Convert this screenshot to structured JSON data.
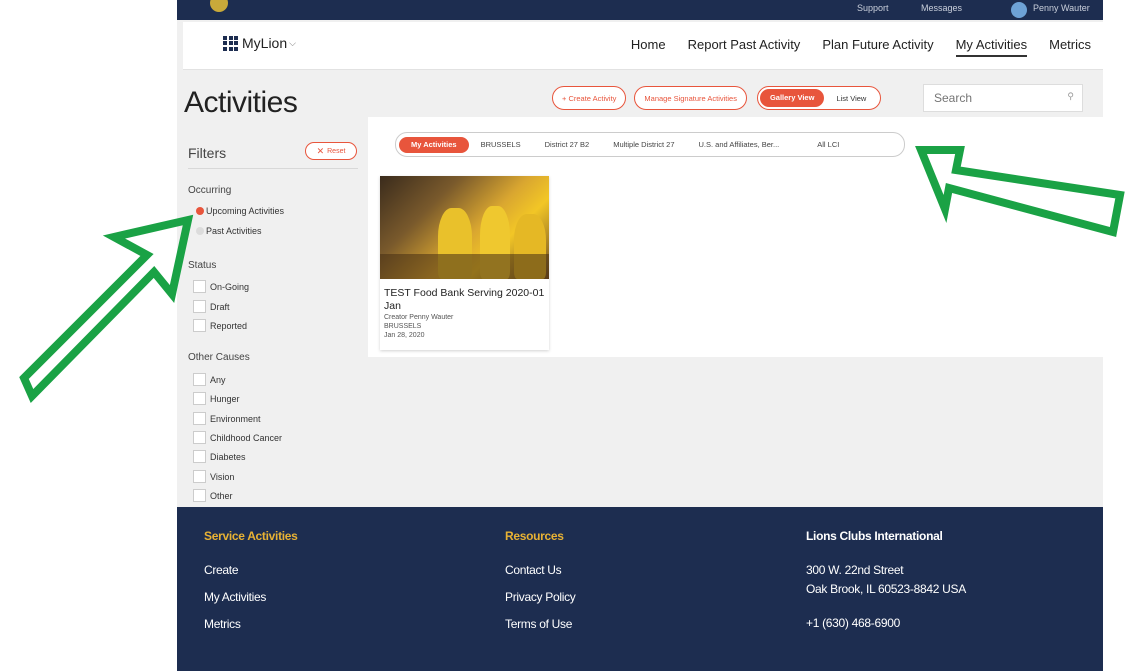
{
  "topbar": {
    "support": "Support",
    "messages": "Messages",
    "user": "Penny Wauter"
  },
  "nav": {
    "brand": "MyLion",
    "links": [
      "Home",
      "Report Past Activity",
      "Plan Future Activity",
      "My Activities",
      "Metrics"
    ]
  },
  "page": {
    "title": "Activities"
  },
  "actions": {
    "create": "+ Create Activity",
    "manage": "Manage Signature Activities",
    "gallery": "Gallery View",
    "list": "List View"
  },
  "search": {
    "placeholder": "Search",
    "icon": "search-icon"
  },
  "filters": {
    "title": "Filters",
    "reset": "Reset",
    "occurring": {
      "label": "Occurring",
      "options": [
        "Upcoming Activities",
        "Past Activities"
      ],
      "selected": "Upcoming Activities"
    },
    "status": {
      "label": "Status",
      "options": [
        "On-Going",
        "Draft",
        "Reported"
      ]
    },
    "causes": {
      "label": "Other Causes",
      "options": [
        "Any",
        "Hunger",
        "Environment",
        "Childhood Cancer",
        "Diabetes",
        "Vision",
        "Other"
      ]
    }
  },
  "tabs": [
    "My Activities",
    "BRUSSELS",
    "District 27 B2",
    "Multiple District 27",
    "U.S. and Affiliates, Ber...",
    "All LCI"
  ],
  "card": {
    "title": "TEST Food Bank Serving 2020-01 Jan",
    "creator": "Creator Penny Wauter",
    "club": "BRUSSELS",
    "date": "Jan 28, 2020"
  },
  "footer": {
    "col1": {
      "heading": "Service Activities",
      "links": [
        "Create",
        "My Activities",
        "Metrics"
      ]
    },
    "col2": {
      "heading": "Resources",
      "links": [
        "Contact Us",
        "Privacy Policy",
        "Terms of Use"
      ]
    },
    "col3": {
      "heading": "Lions Clubs International",
      "lines": [
        "300 W. 22nd Street",
        "Oak Brook, IL 60523-8842 USA",
        "+1 (630) 468-6900"
      ]
    }
  },
  "colors": {
    "accent": "#e8553c",
    "navy": "#1d2d50",
    "gold": "#e8b234",
    "arrow": "#1aa245"
  }
}
